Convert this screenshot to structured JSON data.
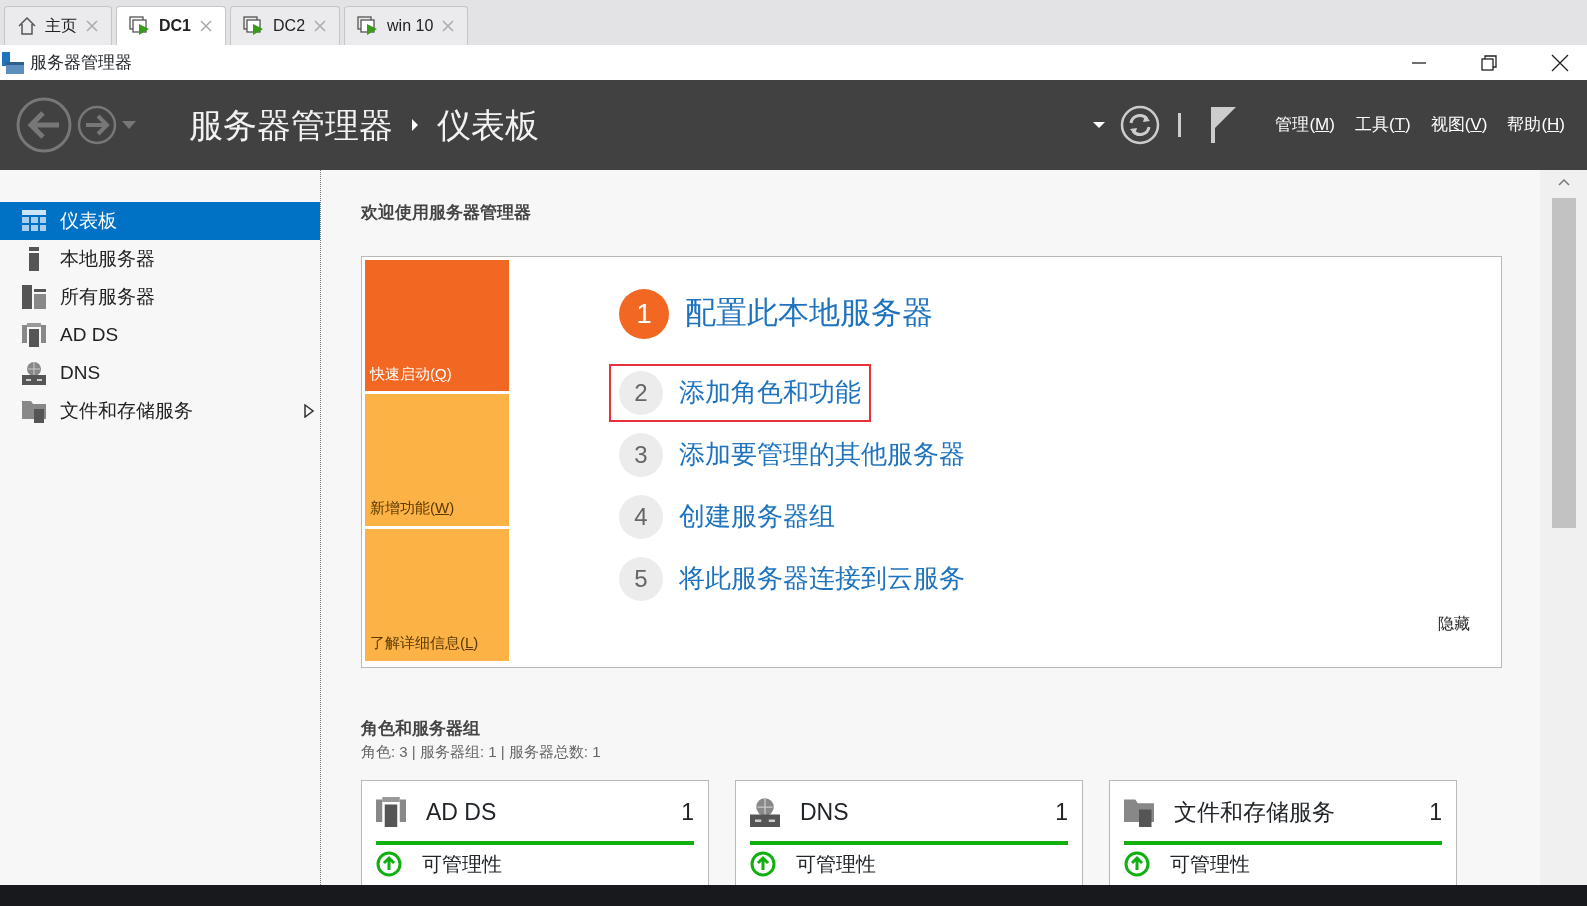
{
  "browser_tabs": [
    {
      "label": "主页",
      "kind": "home",
      "selected": false
    },
    {
      "label": "DC1",
      "kind": "vm",
      "selected": true
    },
    {
      "label": "DC2",
      "kind": "vm",
      "selected": false
    },
    {
      "label": "win 10",
      "kind": "vm",
      "selected": false
    }
  ],
  "window": {
    "title": "服务器管理器"
  },
  "header": {
    "breadcrumb": [
      "服务器管理器",
      "仪表板"
    ],
    "menus": [
      {
        "label": "管理(M)"
      },
      {
        "label": "工具(T)"
      },
      {
        "label": "视图(V)"
      },
      {
        "label": "帮助(H)"
      }
    ]
  },
  "sidebar": {
    "items": [
      {
        "label": "仪表板",
        "kind": "dashboard",
        "selected": true,
        "has_submenu": false
      },
      {
        "label": "本地服务器",
        "kind": "local",
        "selected": false,
        "has_submenu": false
      },
      {
        "label": "所有服务器",
        "kind": "all",
        "selected": false,
        "has_submenu": false
      },
      {
        "label": "AD DS",
        "kind": "adds",
        "selected": false,
        "has_submenu": false
      },
      {
        "label": "DNS",
        "kind": "dns",
        "selected": false,
        "has_submenu": false
      },
      {
        "label": "文件和存储服务",
        "kind": "files",
        "selected": false,
        "has_submenu": true
      }
    ]
  },
  "welcome": {
    "title": "欢迎使用服务器管理器",
    "tiles": [
      {
        "label": "快速启动(Q)",
        "selected": true
      },
      {
        "label": "新增功能(W)",
        "selected": false
      },
      {
        "label": "了解详细信息(L)",
        "selected": false
      }
    ],
    "steps": [
      {
        "number": "1",
        "label": "配置此本地服务器",
        "selected": true,
        "highlighted": false
      },
      {
        "number": "2",
        "label": "添加角色和功能",
        "selected": false,
        "highlighted": true
      },
      {
        "number": "3",
        "label": "添加要管理的其他服务器",
        "selected": false,
        "highlighted": false
      },
      {
        "number": "4",
        "label": "创建服务器组",
        "selected": false,
        "highlighted": false
      },
      {
        "number": "5",
        "label": "将此服务器连接到云服务",
        "selected": false,
        "highlighted": false
      }
    ],
    "hide": "隐藏"
  },
  "roles": {
    "title": "角色和服务器组",
    "summary": "角色: 3 | 服务器组: 1 | 服务器总数: 1",
    "cards": [
      {
        "name": "AD DS",
        "kind": "adds",
        "count": "1",
        "status": "可管理性"
      },
      {
        "name": "DNS",
        "kind": "dns",
        "count": "1",
        "status": "可管理性"
      },
      {
        "name": "文件和存储服务",
        "kind": "files",
        "count": "1",
        "status": "可管理性"
      }
    ]
  }
}
